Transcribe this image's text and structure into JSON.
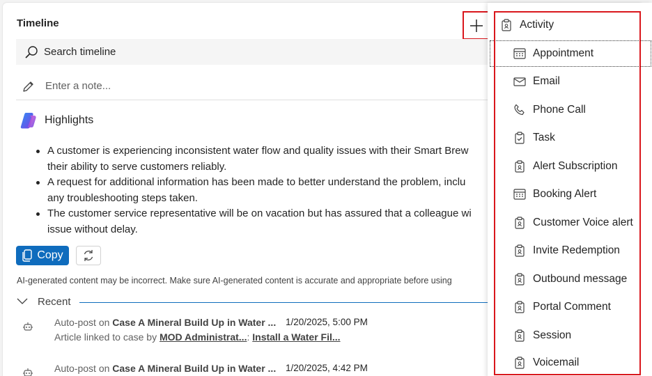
{
  "timeline": {
    "title": "Timeline",
    "search_placeholder": "Search timeline",
    "note_placeholder": "Enter a note...",
    "highlights_label": "Highlights",
    "bullets": [
      "A customer is experiencing inconsistent water flow and quality issues with their Smart Brew",
      "their ability to serve customers reliably.",
      "A request for additional information has been made to better understand the problem, inclu",
      "any troubleshooting steps taken.",
      "The customer service representative will be on vacation but has assured that a colleague wi",
      "issue without delay."
    ],
    "copy_label": "Copy",
    "disclaimer": "AI-generated content may be incorrect. Make sure AI-generated content is accurate and appropriate before using",
    "recent_label": "Recent",
    "posts": [
      {
        "prefix": "Auto-post on",
        "case": "Case A Mineral Build Up in Water ...",
        "date": "1/20/2025, 5:00 PM",
        "line2_prefix": "Article linked to case by",
        "user": "MOD Administrat...",
        "sep": ":",
        "article": "Install a Water Fil..."
      },
      {
        "prefix": "Auto-post on",
        "case": "Case A Mineral Build Up in Water ...",
        "date": "1/20/2025, 4:42 PM"
      }
    ]
  },
  "menu": {
    "header": {
      "label": "Activity",
      "icon": "clipboard-icon"
    },
    "items": [
      {
        "label": "Appointment",
        "icon": "calendar-icon"
      },
      {
        "label": "Email",
        "icon": "mail-icon"
      },
      {
        "label": "Phone Call",
        "icon": "phone-icon"
      },
      {
        "label": "Task",
        "icon": "task-icon"
      },
      {
        "label": "Alert Subscription",
        "icon": "clipboard-icon"
      },
      {
        "label": "Booking Alert",
        "icon": "calendar-icon"
      },
      {
        "label": "Customer Voice alert",
        "icon": "clipboard-icon"
      },
      {
        "label": "Invite Redemption",
        "icon": "clipboard-icon"
      },
      {
        "label": "Outbound message",
        "icon": "clipboard-icon"
      },
      {
        "label": "Portal Comment",
        "icon": "clipboard-icon"
      },
      {
        "label": "Session",
        "icon": "clipboard-icon"
      },
      {
        "label": "Voicemail",
        "icon": "clipboard-icon"
      }
    ]
  },
  "colors": {
    "accent": "#0f6cbd",
    "highlight_box": "#d9161c"
  }
}
